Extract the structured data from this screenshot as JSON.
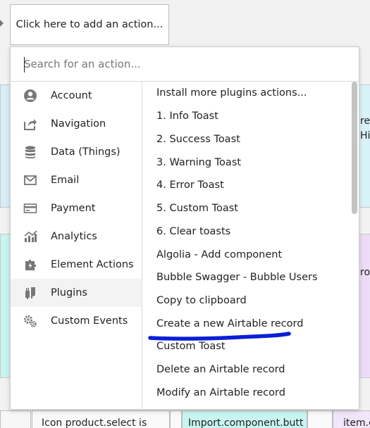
{
  "background": {
    "top_action_label": "Click here to add an action...",
    "right_text": [
      "rea",
      "Hi",
      "rou"
    ],
    "bottom_row": [
      "",
      "Icon product.select is",
      "",
      "Import.component.butt",
      "",
      "item.c"
    ]
  },
  "picker": {
    "search_placeholder": "Search for an action...",
    "search_value": "",
    "categories": [
      {
        "label": "Account",
        "icon": "account-icon"
      },
      {
        "label": "Navigation",
        "icon": "navigation-icon"
      },
      {
        "label": "Data (Things)",
        "icon": "database-icon"
      },
      {
        "label": "Email",
        "icon": "email-icon"
      },
      {
        "label": "Payment",
        "icon": "payment-icon"
      },
      {
        "label": "Analytics",
        "icon": "analytics-icon"
      },
      {
        "label": "Element Actions",
        "icon": "element-actions-icon"
      },
      {
        "label": "Plugins",
        "icon": "plugins-icon",
        "selected": true
      },
      {
        "label": "Custom Events",
        "icon": "custom-events-icon"
      }
    ],
    "actions": [
      "Install more plugins actions...",
      "1. Info Toast",
      "2. Success Toast",
      "3. Warning Toast",
      "4. Error Toast",
      "5. Custom Toast",
      "6. Clear toasts",
      "Algolia - Add component",
      "Bubble Swagger - Bubble Users",
      "Copy to clipboard",
      "Create a new Airtable record",
      "Custom Toast",
      "Delete an Airtable record",
      "Modify an Airtable record"
    ],
    "highlight_color": "#0a1fd6"
  }
}
